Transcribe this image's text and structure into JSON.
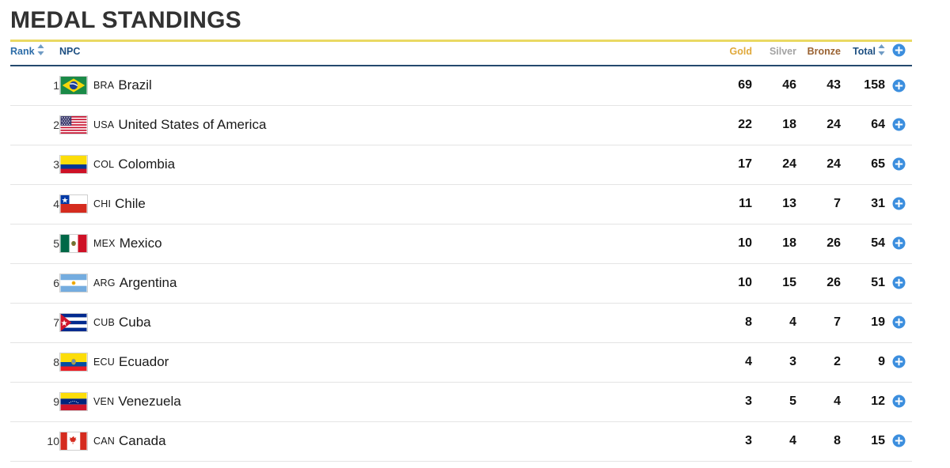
{
  "page": {
    "title": "MEDAL STANDINGS",
    "accent_rule_color": "#ead963",
    "header_border_color": "#24496e"
  },
  "table": {
    "headers": {
      "rank": "Rank",
      "npc": "NPC",
      "gold": "Gold",
      "silver": "Silver",
      "bronze": "Bronze",
      "total": "Total",
      "expand_icon": "plus-circle-icon",
      "rank_sort_icon": "sort-updown-icon",
      "total_sort_icon": "sort-updown-icon"
    },
    "header_colors": {
      "gold": "#e0a93b",
      "silver": "#a3a3a3",
      "bronze": "#9a6232",
      "total": "#1d4f82",
      "rank": "#2c6ca8",
      "npc": "#1d4f82"
    },
    "rows": [
      {
        "rank": "1",
        "code": "BRA",
        "name": "Brazil",
        "gold": "69",
        "silver": "46",
        "bronze": "43",
        "total": "158",
        "flag": "brazil-flag-icon",
        "expand_icon": "plus-circle-icon"
      },
      {
        "rank": "2",
        "code": "USA",
        "name": "United States of America",
        "gold": "22",
        "silver": "18",
        "bronze": "24",
        "total": "64",
        "flag": "usa-flag-icon",
        "expand_icon": "plus-circle-icon"
      },
      {
        "rank": "3",
        "code": "COL",
        "name": "Colombia",
        "gold": "17",
        "silver": "24",
        "bronze": "24",
        "total": "65",
        "flag": "colombia-flag-icon",
        "expand_icon": "plus-circle-icon"
      },
      {
        "rank": "4",
        "code": "CHI",
        "name": "Chile",
        "gold": "11",
        "silver": "13",
        "bronze": "7",
        "total": "31",
        "flag": "chile-flag-icon",
        "expand_icon": "plus-circle-icon"
      },
      {
        "rank": "5",
        "code": "MEX",
        "name": "Mexico",
        "gold": "10",
        "silver": "18",
        "bronze": "26",
        "total": "54",
        "flag": "mexico-flag-icon",
        "expand_icon": "plus-circle-icon"
      },
      {
        "rank": "6",
        "code": "ARG",
        "name": "Argentina",
        "gold": "10",
        "silver": "15",
        "bronze": "26",
        "total": "51",
        "flag": "argentina-flag-icon",
        "expand_icon": "plus-circle-icon"
      },
      {
        "rank": "7",
        "code": "CUB",
        "name": "Cuba",
        "gold": "8",
        "silver": "4",
        "bronze": "7",
        "total": "19",
        "flag": "cuba-flag-icon",
        "expand_icon": "plus-circle-icon"
      },
      {
        "rank": "8",
        "code": "ECU",
        "name": "Ecuador",
        "gold": "4",
        "silver": "3",
        "bronze": "2",
        "total": "9",
        "flag": "ecuador-flag-icon",
        "expand_icon": "plus-circle-icon"
      },
      {
        "rank": "9",
        "code": "VEN",
        "name": "Venezuela",
        "gold": "3",
        "silver": "5",
        "bronze": "4",
        "total": "12",
        "flag": "venezuela-flag-icon",
        "expand_icon": "plus-circle-icon"
      },
      {
        "rank": "10",
        "code": "CAN",
        "name": "Canada",
        "gold": "3",
        "silver": "4",
        "bronze": "8",
        "total": "15",
        "flag": "canada-flag-icon",
        "expand_icon": "plus-circle-icon"
      }
    ]
  }
}
